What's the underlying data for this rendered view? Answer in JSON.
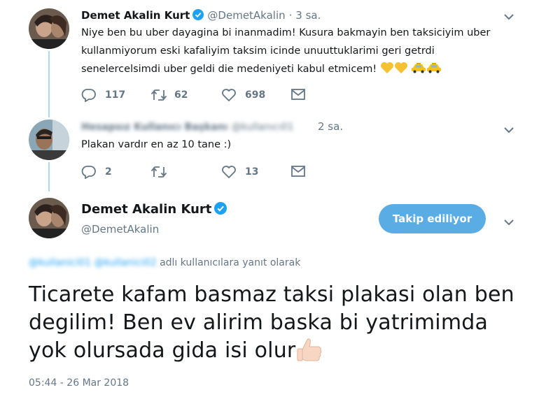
{
  "tweet1": {
    "name": "Demet Akalin Kurt",
    "handle": "@DemetAkalin",
    "time": "· 3 sa.",
    "lines": [
      "Niye ben bu uber dayagina bi inanmadim! Kusura bakmayin ben taksiciyim uber",
      "kullanmiyorum eski kafaliyim taksim icinde unuuttuklarimi geri getrdi",
      "senelercelsimdi uber geldi die medeniyeti kabul etmicem!"
    ],
    "emoji": [
      "yellow-heart",
      "yellow-heart",
      "taxi",
      "taxi"
    ],
    "replies": "117",
    "retweets": "62",
    "likes": "698"
  },
  "tweet2": {
    "name": "Hesapsız Kullanıcı Başkanı",
    "handle": "@kullanıcı01",
    "time": "2 sa.",
    "text": "Plakan vardır en az 10 tane :)",
    "replies": "2",
    "retweets": "",
    "likes": "13"
  },
  "main": {
    "name": "Demet Akalin Kurt",
    "handle": "@DemetAkalin",
    "follow_label": "Takip ediliyor",
    "reply_context_blurred": "@kullanici01 @kullanici02",
    "reply_context": "adlı kullanıcılara yanıt olarak",
    "lines": [
      "Ticarete kafam basmaz taksi plakasi olan ben",
      "degilim! Ben ev alirim baska bi yatrimimda",
      "yok olursada gida isi olur"
    ],
    "emoji": "thumbs-up",
    "timestamp": "05:44 - 26 Mar 2018"
  },
  "colors": {
    "accent": "#1da1f2",
    "follow_button": "#5aace4",
    "thread_line": "#a7dcf5",
    "muted": "#657786"
  }
}
